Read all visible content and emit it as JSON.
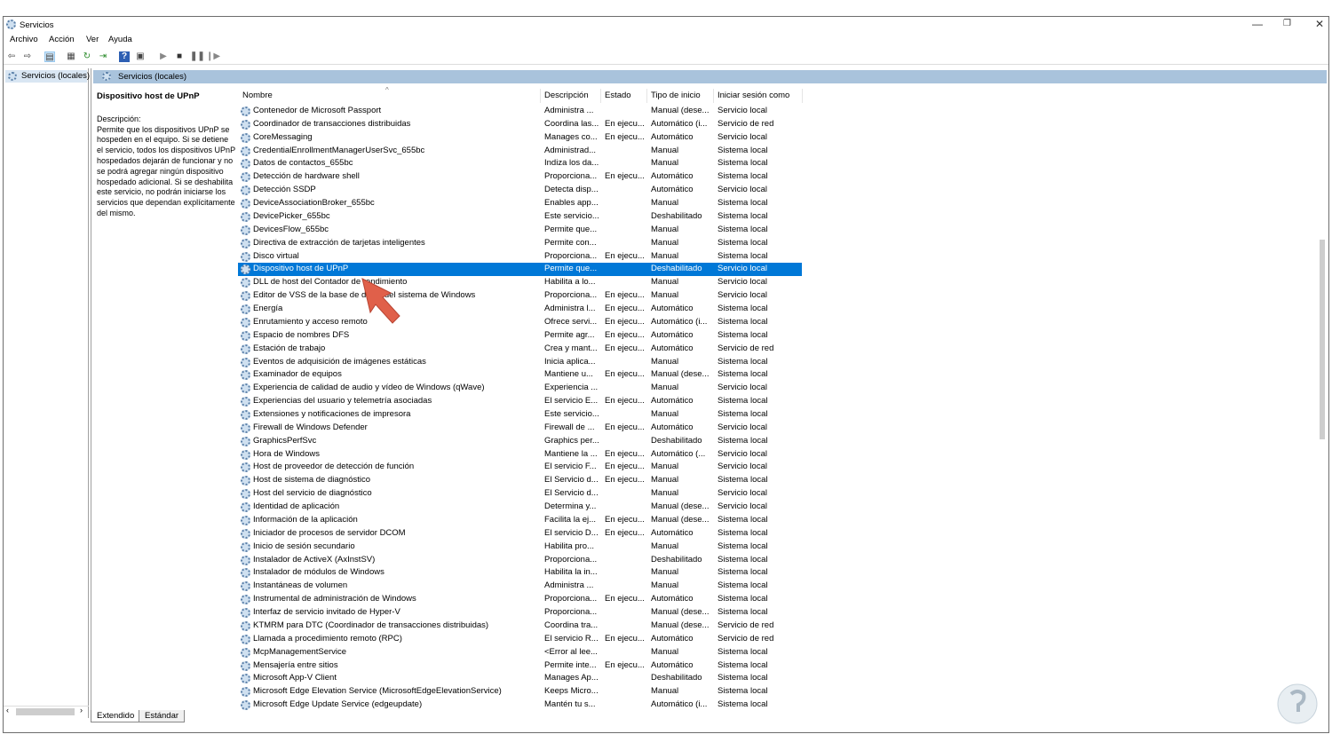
{
  "window": {
    "title": "Servicios",
    "minimize": "—",
    "restore": "❐",
    "close": "✕"
  },
  "menu": [
    "Archivo",
    "Acción",
    "Ver",
    "Ayuda"
  ],
  "toolbar": {
    "icons": [
      "back-icon",
      "forward-icon",
      "show-hide-console-tree-icon",
      "properties-icon",
      "refresh-icon",
      "export-list-icon",
      "help-icon",
      "show-hide-action-pane-icon",
      "start-service-icon",
      "stop-service-icon",
      "pause-service-icon",
      "resume-service-icon"
    ]
  },
  "tree": {
    "root": "Servicios (locales)"
  },
  "panel": {
    "header": "Servicios (locales)",
    "selected_title": "Dispositivo host de UPnP",
    "desc_label": "Descripción:",
    "description": "Permite que los dispositivos UPnP se hospeden en el equipo. Si se detiene el servicio, todos los dispositivos UPnP hospedados dejarán de funcionar y no se podrá agregar ningún dispositivo hospedado adicional. Si se deshabilita este servicio, no podrán iniciarse los servicios que dependan explícitamente del mismo."
  },
  "columns": {
    "name": "Nombre",
    "desc": "Descripción",
    "state": "Estado",
    "startup": "Tipo de inicio",
    "logon": "Iniciar sesión como"
  },
  "selected_index": 12,
  "colors": {
    "selection": "#0078d7",
    "header_bar": "#a9c3dc",
    "annotation_arrow": "#e0604a"
  },
  "rows": [
    [
      "Contenedor de Microsoft Passport",
      "Administra ...",
      "",
      "Manual (dese...",
      "Servicio local"
    ],
    [
      "Coordinador de transacciones distribuidas",
      "Coordina las...",
      "En ejecu...",
      "Automático (i...",
      "Servicio de red"
    ],
    [
      "CoreMessaging",
      "Manages co...",
      "En ejecu...",
      "Automático",
      "Servicio local"
    ],
    [
      "CredentialEnrollmentManagerUserSvc_655bc",
      "Administrad...",
      "",
      "Manual",
      "Sistema local"
    ],
    [
      "Datos de contactos_655bc",
      "Indiza los da...",
      "",
      "Manual",
      "Sistema local"
    ],
    [
      "Detección de hardware shell",
      "Proporciona...",
      "En ejecu...",
      "Automático",
      "Sistema local"
    ],
    [
      "Detección SSDP",
      "Detecta disp...",
      "",
      "Automático",
      "Servicio local"
    ],
    [
      "DeviceAssociationBroker_655bc",
      "Enables app...",
      "",
      "Manual",
      "Sistema local"
    ],
    [
      "DevicePicker_655bc",
      "Este servicio...",
      "",
      "Deshabilitado",
      "Sistema local"
    ],
    [
      "DevicesFlow_655bc",
      "Permite que...",
      "",
      "Manual",
      "Sistema local"
    ],
    [
      "Directiva de extracción de tarjetas inteligentes",
      "Permite con...",
      "",
      "Manual",
      "Sistema local"
    ],
    [
      "Disco virtual",
      "Proporciona...",
      "En ejecu...",
      "Manual",
      "Sistema local"
    ],
    [
      "Dispositivo host de UPnP",
      "Permite que...",
      "",
      "Deshabilitado",
      "Servicio local"
    ],
    [
      "DLL de host del Contador de rendimiento",
      "Habilita a lo...",
      "",
      "Manual",
      "Servicio local"
    ],
    [
      "Editor de VSS de la base de datos del sistema de Windows",
      "Proporciona...",
      "En ejecu...",
      "Manual",
      "Servicio local"
    ],
    [
      "Energía",
      "Administra l...",
      "En ejecu...",
      "Automático",
      "Sistema local"
    ],
    [
      "Enrutamiento y acceso remoto",
      "Ofrece servi...",
      "En ejecu...",
      "Automático (i...",
      "Sistema local"
    ],
    [
      "Espacio de nombres DFS",
      "Permite agr...",
      "En ejecu...",
      "Automático",
      "Sistema local"
    ],
    [
      "Estación de trabajo",
      "Crea y mant...",
      "En ejecu...",
      "Automático",
      "Servicio de red"
    ],
    [
      "Eventos de adquisición de imágenes estáticas",
      "Inicia aplica...",
      "",
      "Manual",
      "Sistema local"
    ],
    [
      "Examinador de equipos",
      "Mantiene u...",
      "En ejecu...",
      "Manual (dese...",
      "Sistema local"
    ],
    [
      "Experiencia de calidad de audio y vídeo de Windows (qWave)",
      "Experiencia ...",
      "",
      "Manual",
      "Servicio local"
    ],
    [
      "Experiencias del usuario y telemetría asociadas",
      "El servicio E...",
      "En ejecu...",
      "Automático",
      "Sistema local"
    ],
    [
      "Extensiones y notificaciones de impresora",
      "Este servicio...",
      "",
      "Manual",
      "Sistema local"
    ],
    [
      "Firewall de Windows Defender",
      "Firewall de ...",
      "En ejecu...",
      "Automático",
      "Servicio local"
    ],
    [
      "GraphicsPerfSvc",
      "Graphics per...",
      "",
      "Deshabilitado",
      "Sistema local"
    ],
    [
      "Hora de Windows",
      "Mantiene la ...",
      "En ejecu...",
      "Automático (...",
      "Servicio local"
    ],
    [
      "Host de proveedor de detección de función",
      "El servicio F...",
      "En ejecu...",
      "Manual",
      "Servicio local"
    ],
    [
      "Host de sistema de diagnóstico",
      "El Servicio d...",
      "En ejecu...",
      "Manual",
      "Sistema local"
    ],
    [
      "Host del servicio de diagnóstico",
      "El Servicio d...",
      "",
      "Manual",
      "Servicio local"
    ],
    [
      "Identidad de aplicación",
      "Determina y...",
      "",
      "Manual (dese...",
      "Servicio local"
    ],
    [
      "Información de la aplicación",
      "Facilita la ej...",
      "En ejecu...",
      "Manual (dese...",
      "Sistema local"
    ],
    [
      "Iniciador de procesos de servidor DCOM",
      "El servicio D...",
      "En ejecu...",
      "Automático",
      "Sistema local"
    ],
    [
      "Inicio de sesión secundario",
      "Habilita pro...",
      "",
      "Manual",
      "Sistema local"
    ],
    [
      "Instalador de ActiveX (AxInstSV)",
      "Proporciona...",
      "",
      "Deshabilitado",
      "Sistema local"
    ],
    [
      "Instalador de módulos de Windows",
      "Habilita la in...",
      "",
      "Manual",
      "Sistema local"
    ],
    [
      "Instantáneas de volumen",
      "Administra ...",
      "",
      "Manual",
      "Sistema local"
    ],
    [
      "Instrumental de administración de Windows",
      "Proporciona...",
      "En ejecu...",
      "Automático",
      "Sistema local"
    ],
    [
      "Interfaz de servicio invitado de Hyper-V",
      "Proporciona...",
      "",
      "Manual (dese...",
      "Sistema local"
    ],
    [
      "KTMRM para DTC (Coordinador de transacciones distribuidas)",
      "Coordina tra...",
      "",
      "Manual (dese...",
      "Servicio de red"
    ],
    [
      "Llamada a procedimiento remoto (RPC)",
      "El servicio R...",
      "En ejecu...",
      "Automático",
      "Servicio de red"
    ],
    [
      "McpManagementService",
      "<Error al lee...",
      "",
      "Manual",
      "Sistema local"
    ],
    [
      "Mensajería entre sitios",
      "Permite inte...",
      "En ejecu...",
      "Automático",
      "Sistema local"
    ],
    [
      "Microsoft App-V Client",
      "Manages Ap...",
      "",
      "Deshabilitado",
      "Sistema local"
    ],
    [
      "Microsoft Edge Elevation Service (MicrosoftEdgeElevationService)",
      "Keeps Micro...",
      "",
      "Manual",
      "Sistema local"
    ],
    [
      "Microsoft Edge Update Service (edgeupdate)",
      "Mantén tu s...",
      "",
      "Automático (i...",
      "Sistema local"
    ]
  ],
  "tabs": [
    "Extendido",
    "Estándar"
  ]
}
